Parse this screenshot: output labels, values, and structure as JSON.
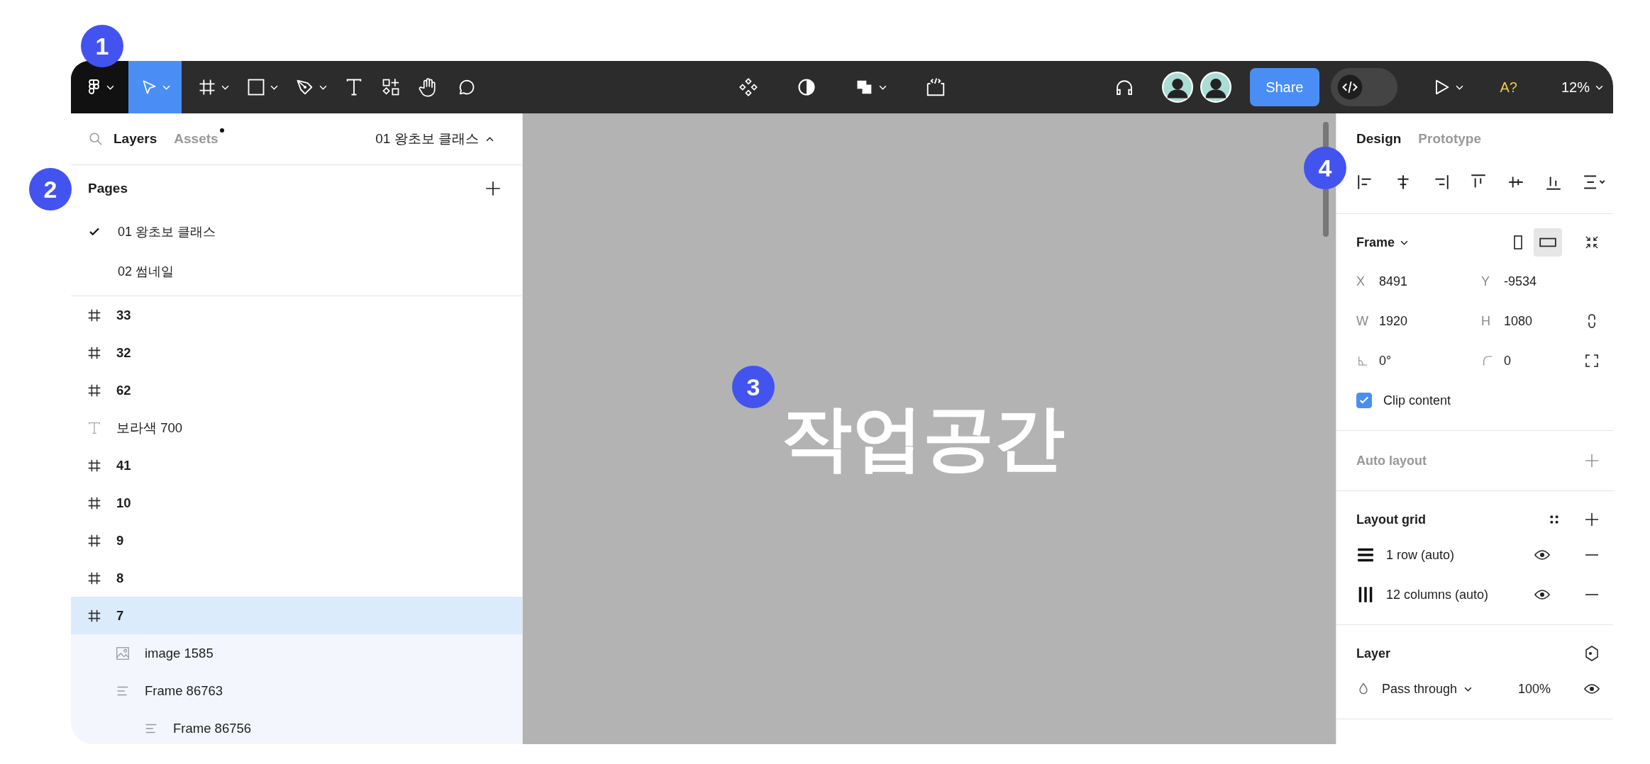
{
  "badges": [
    "1",
    "2",
    "3",
    "4"
  ],
  "toolbar": {
    "tools": [
      {
        "kind": "main-menu",
        "selected": false,
        "dropdown": true
      },
      {
        "kind": "move",
        "selected": true,
        "dropdown": true
      },
      {
        "kind": "frame",
        "selected": false,
        "dropdown": true
      },
      {
        "kind": "shape",
        "selected": false,
        "dropdown": true
      },
      {
        "kind": "pen",
        "selected": false,
        "dropdown": true
      },
      {
        "kind": "text",
        "selected": false,
        "dropdown": false
      },
      {
        "kind": "resources",
        "selected": false,
        "dropdown": false
      },
      {
        "kind": "hand",
        "selected": false,
        "dropdown": false
      },
      {
        "kind": "comment",
        "selected": false,
        "dropdown": false
      }
    ],
    "center_tools": [
      {
        "kind": "components",
        "dropdown": false
      },
      {
        "kind": "contrast",
        "dropdown": false
      },
      {
        "kind": "boolean",
        "dropdown": true
      },
      {
        "kind": "dev-handoff",
        "dropdown": false
      }
    ],
    "avatars": [
      {
        "kind": "user"
      },
      {
        "kind": "user"
      }
    ],
    "share_button": "Share",
    "dev_mode": {
      "on": false
    },
    "present": {
      "dropdown": true
    },
    "font_warning": "A?",
    "zoom": "12%"
  },
  "layers_panel": {
    "tabs": [
      {
        "label": "Layers",
        "selected": true,
        "dot": false
      },
      {
        "label": "Assets",
        "selected": false,
        "dot": true
      }
    ],
    "current_page": "01 왕초보 클래스",
    "pages_title": "Pages",
    "pages": [
      {
        "name": "01 왕초보 클래스",
        "selected": true
      },
      {
        "name": "02 썸네일",
        "selected": false
      }
    ],
    "layers": [
      {
        "name": "33",
        "kind": "frame",
        "selected": false
      },
      {
        "name": "32",
        "kind": "frame",
        "selected": false
      },
      {
        "name": "62",
        "kind": "frame",
        "selected": false
      },
      {
        "name": "보라색 700",
        "kind": "text",
        "selected": false
      },
      {
        "name": "41",
        "kind": "frame",
        "selected": false
      },
      {
        "name": "10",
        "kind": "frame",
        "selected": false
      },
      {
        "name": "9",
        "kind": "frame",
        "selected": false
      },
      {
        "name": "8",
        "kind": "frame",
        "selected": false
      },
      {
        "name": "7",
        "kind": "frame",
        "selected": true,
        "children": [
          {
            "name": "image 1585",
            "kind": "image",
            "selected": false
          },
          {
            "name": "Frame 86763",
            "kind": "autolayout",
            "selected": false,
            "children": [
              {
                "name": "Frame 86756",
                "kind": "autolayout",
                "selected": false
              }
            ]
          }
        ]
      }
    ]
  },
  "canvas": {
    "text": "작업공간"
  },
  "design_panel": {
    "tabs": [
      {
        "label": "Design",
        "selected": true
      },
      {
        "label": "Prototype",
        "selected": false
      }
    ],
    "frame": {
      "title": "Frame",
      "orientations": [
        {
          "kind": "portrait",
          "selected": false
        },
        {
          "kind": "landscape",
          "selected": true
        }
      ],
      "fields": [
        {
          "kind": "x",
          "label": "X",
          "value": "8491"
        },
        {
          "kind": "y",
          "label": "Y",
          "value": "-9534"
        },
        {
          "kind": "w",
          "label": "W",
          "value": "1920"
        },
        {
          "kind": "h",
          "label": "H",
          "value": "1080"
        },
        {
          "kind": "rotation",
          "value": "0°"
        },
        {
          "kind": "radius",
          "value": "0"
        }
      ],
      "clip_content": {
        "label": "Clip content",
        "checked": true
      }
    },
    "auto_layout": "Auto layout",
    "layout_grid": {
      "title": "Layout grid",
      "grids": [
        {
          "kind": "rows",
          "label": "1 row (auto)",
          "visible": true
        },
        {
          "kind": "columns",
          "label": "12 columns (auto)",
          "visible": true
        }
      ]
    },
    "layer": {
      "title": "Layer",
      "blend": "Pass through",
      "opacity": "100%",
      "visible": true
    }
  }
}
